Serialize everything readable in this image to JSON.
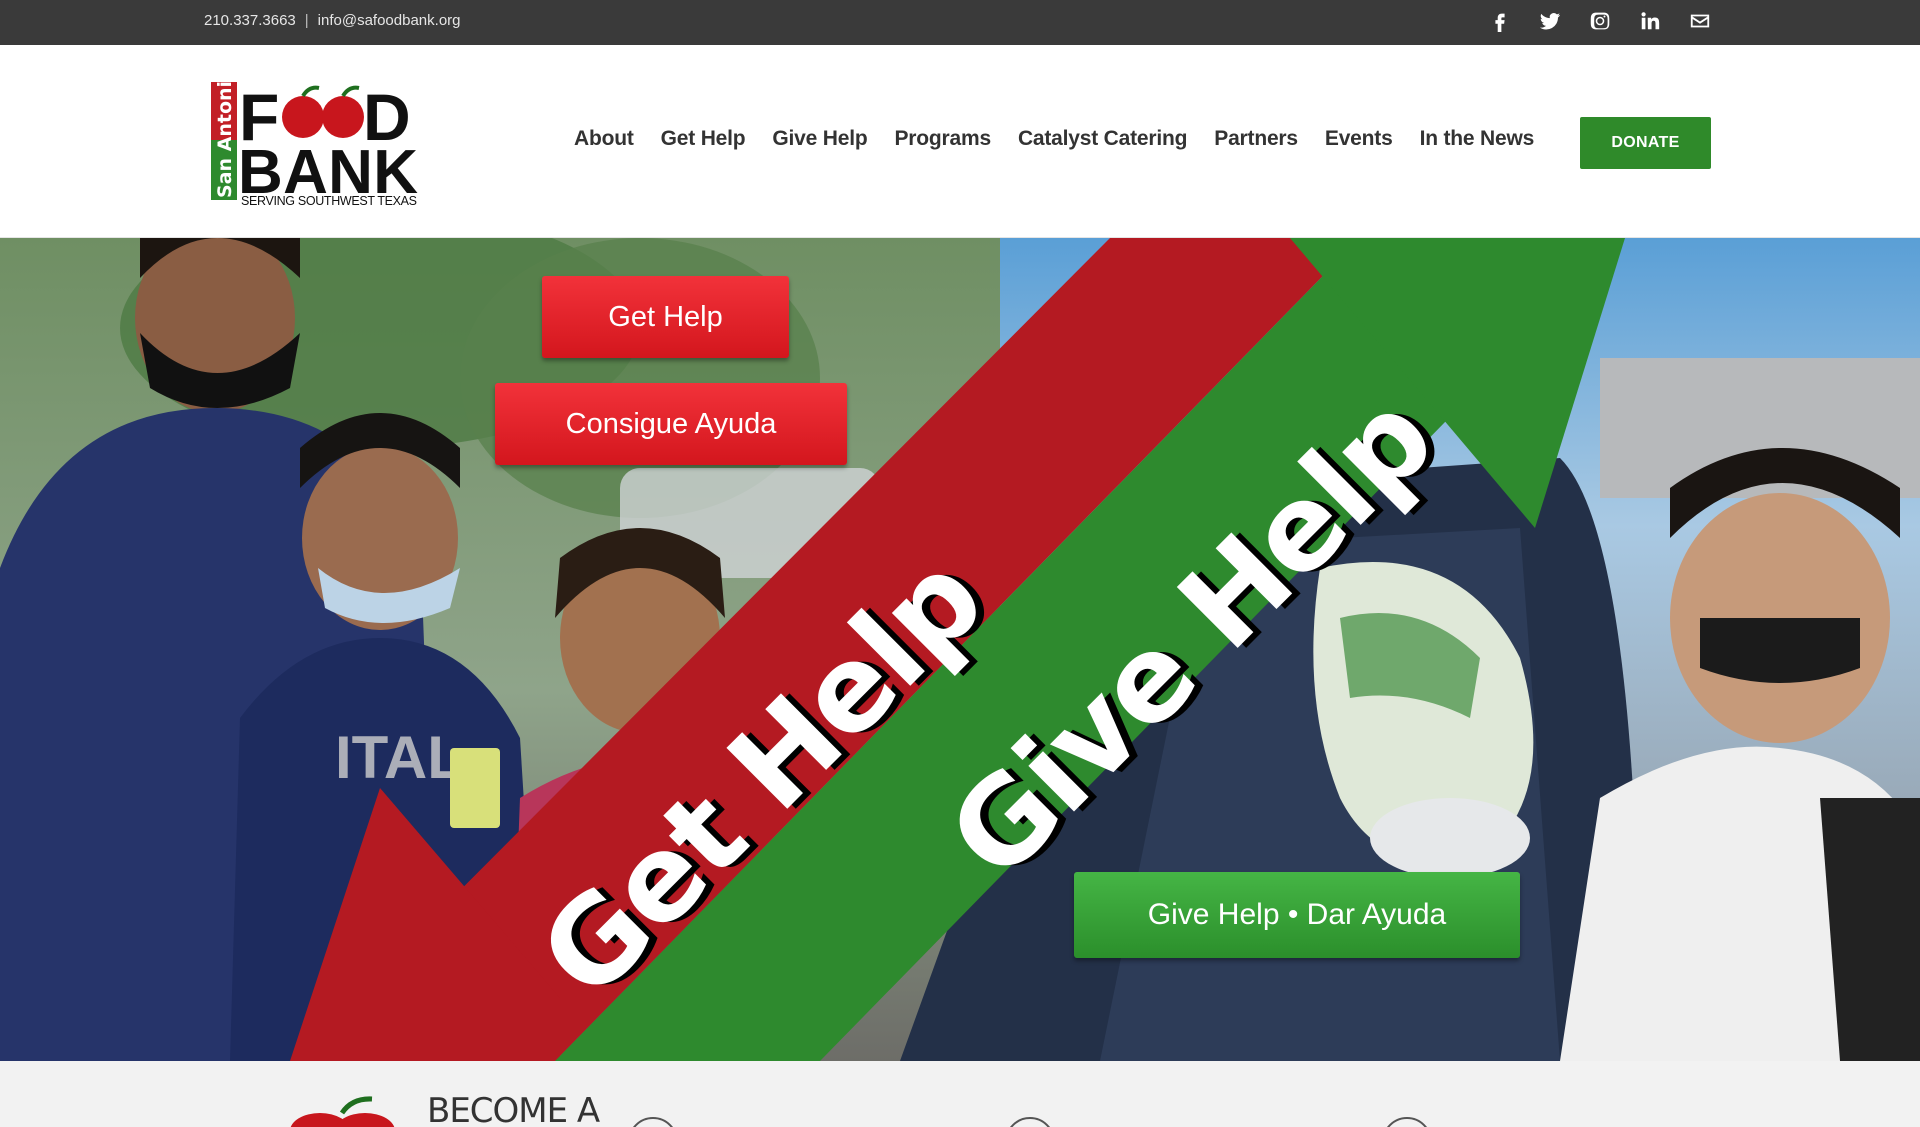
{
  "topbar": {
    "phone": "210.337.3663",
    "separator": "|",
    "email": "info@safoodbank.org",
    "social_icons": [
      "facebook-icon",
      "twitter-icon",
      "instagram-icon",
      "linkedin-icon",
      "envelope-icon"
    ]
  },
  "logo": {
    "line1_left": "F",
    "line1_right": "D",
    "line2": "BANK",
    "side": "San Antonio",
    "tagline": "SERVING SOUTHWEST TEXAS"
  },
  "nav": {
    "items": [
      "About",
      "Get Help",
      "Give Help",
      "Programs",
      "Catalyst Catering",
      "Partners",
      "Events",
      "In the News"
    ],
    "donate_label": "DONATE"
  },
  "hero": {
    "btn_get_help": "Get Help",
    "btn_consigue": "Consigue Ayuda",
    "banner_get": "Get Help",
    "banner_give": "Give Help",
    "btn_give_help": "Give Help • Dar Ayuda",
    "colors": {
      "red": "#b41a22",
      "green": "#2e8a2e"
    }
  },
  "bottom": {
    "become_text": "BECOME A"
  }
}
